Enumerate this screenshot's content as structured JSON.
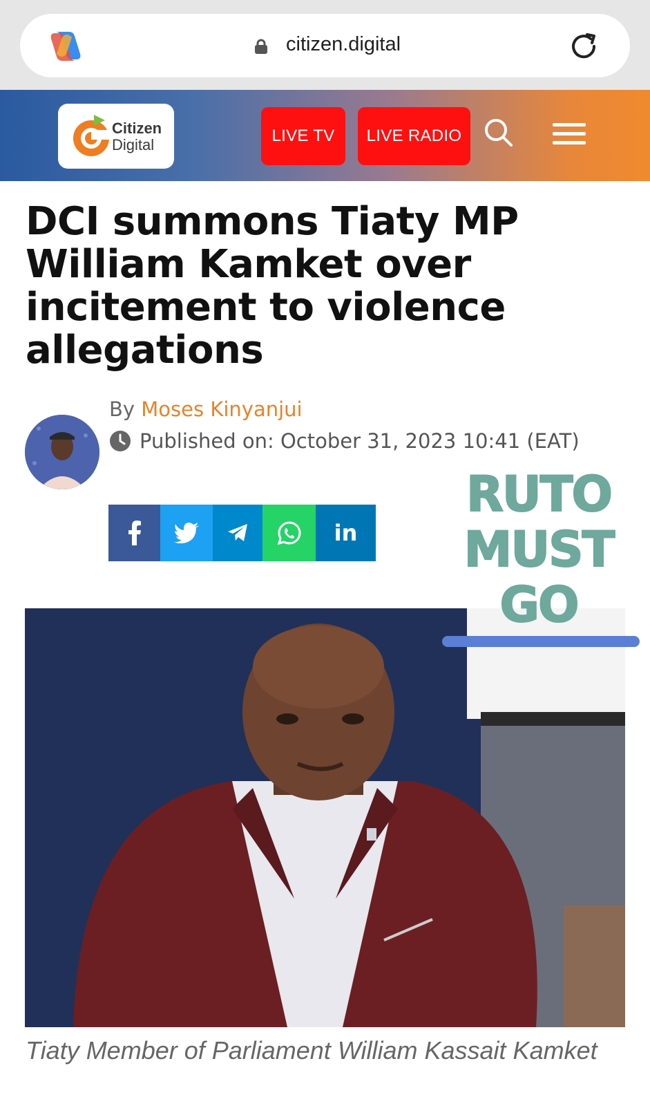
{
  "browser": {
    "url": "citizen.digital"
  },
  "header": {
    "logo_line1": "Citizen",
    "logo_line2": "Digital",
    "live_tv_label": "LIVE TV",
    "live_radio_label": "LIVE RADIO"
  },
  "article": {
    "headline": "DCI summons Tiaty MP William Kamket over incitement to violence allegations",
    "by_prefix": "By ",
    "author": "Moses Kinyanjui",
    "published": "Published on: October 31, 2023 10:41 (EAT)",
    "caption": "Tiaty Member of Parliament William Kassait Kamket"
  },
  "share": {
    "linkedin_label": "in",
    "buttons": [
      "facebook-icon",
      "twitter-icon",
      "telegram-icon",
      "whatsapp-icon",
      "linkedin-icon"
    ]
  },
  "sticker": {
    "line1": "RUTO",
    "line2": "MUST",
    "line3": "GO",
    "color": "#6fa89c"
  },
  "colors": {
    "live_button": "#ff1010",
    "author_link": "#e8822a",
    "header_left": "#2a5aa0",
    "header_right": "#f08a2e"
  }
}
